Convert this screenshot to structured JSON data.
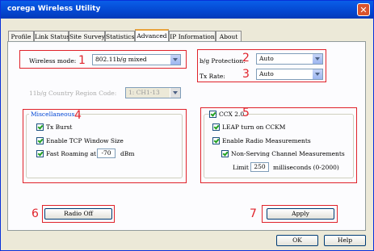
{
  "window": {
    "title": "corega Wireless Utility",
    "close_label": "✕"
  },
  "tabs": [
    "Profile",
    "Link Status",
    "Site Survey",
    "Statistics",
    "Advanced",
    "IP Information",
    "About"
  ],
  "left": {
    "wireless_mode_label": "Wireless mode:",
    "wireless_mode_value": "802.11b/g mixed",
    "region_label": "11b/g Country Region Code:",
    "region_value": "1: CH1-13"
  },
  "right": {
    "protection_label": "b/g Protection:",
    "protection_value": "Auto",
    "txrate_label": "Tx Rate:",
    "txrate_value": "Auto"
  },
  "misc": {
    "title": "Miscellaneous",
    "tx_burst": "Tx Burst",
    "tcp_window": "Enable TCP Window Size",
    "fast_roaming": "Fast Roaming at",
    "roaming_value": "-70",
    "roaming_unit": "dBm"
  },
  "ccx": {
    "title": "CCX 2.0",
    "leap": "LEAP turn on CCKM",
    "radio_meas": "Enable Radio Measurements",
    "non_serving": "Non-Serving Channel Measurements",
    "limit_label": "Limit",
    "limit_value": "250",
    "limit_unit": "milliseconds (0-2000)"
  },
  "buttons": {
    "radio_off": "Radio Off",
    "apply": "Apply",
    "ok": "OK",
    "help": "Help"
  },
  "annotations": [
    "1",
    "2",
    "3",
    "4",
    "5",
    "6",
    "7"
  ],
  "colors": {
    "annotation": "#e0222a",
    "titlebar": "#0447d0",
    "group_title": "#0046d5"
  }
}
